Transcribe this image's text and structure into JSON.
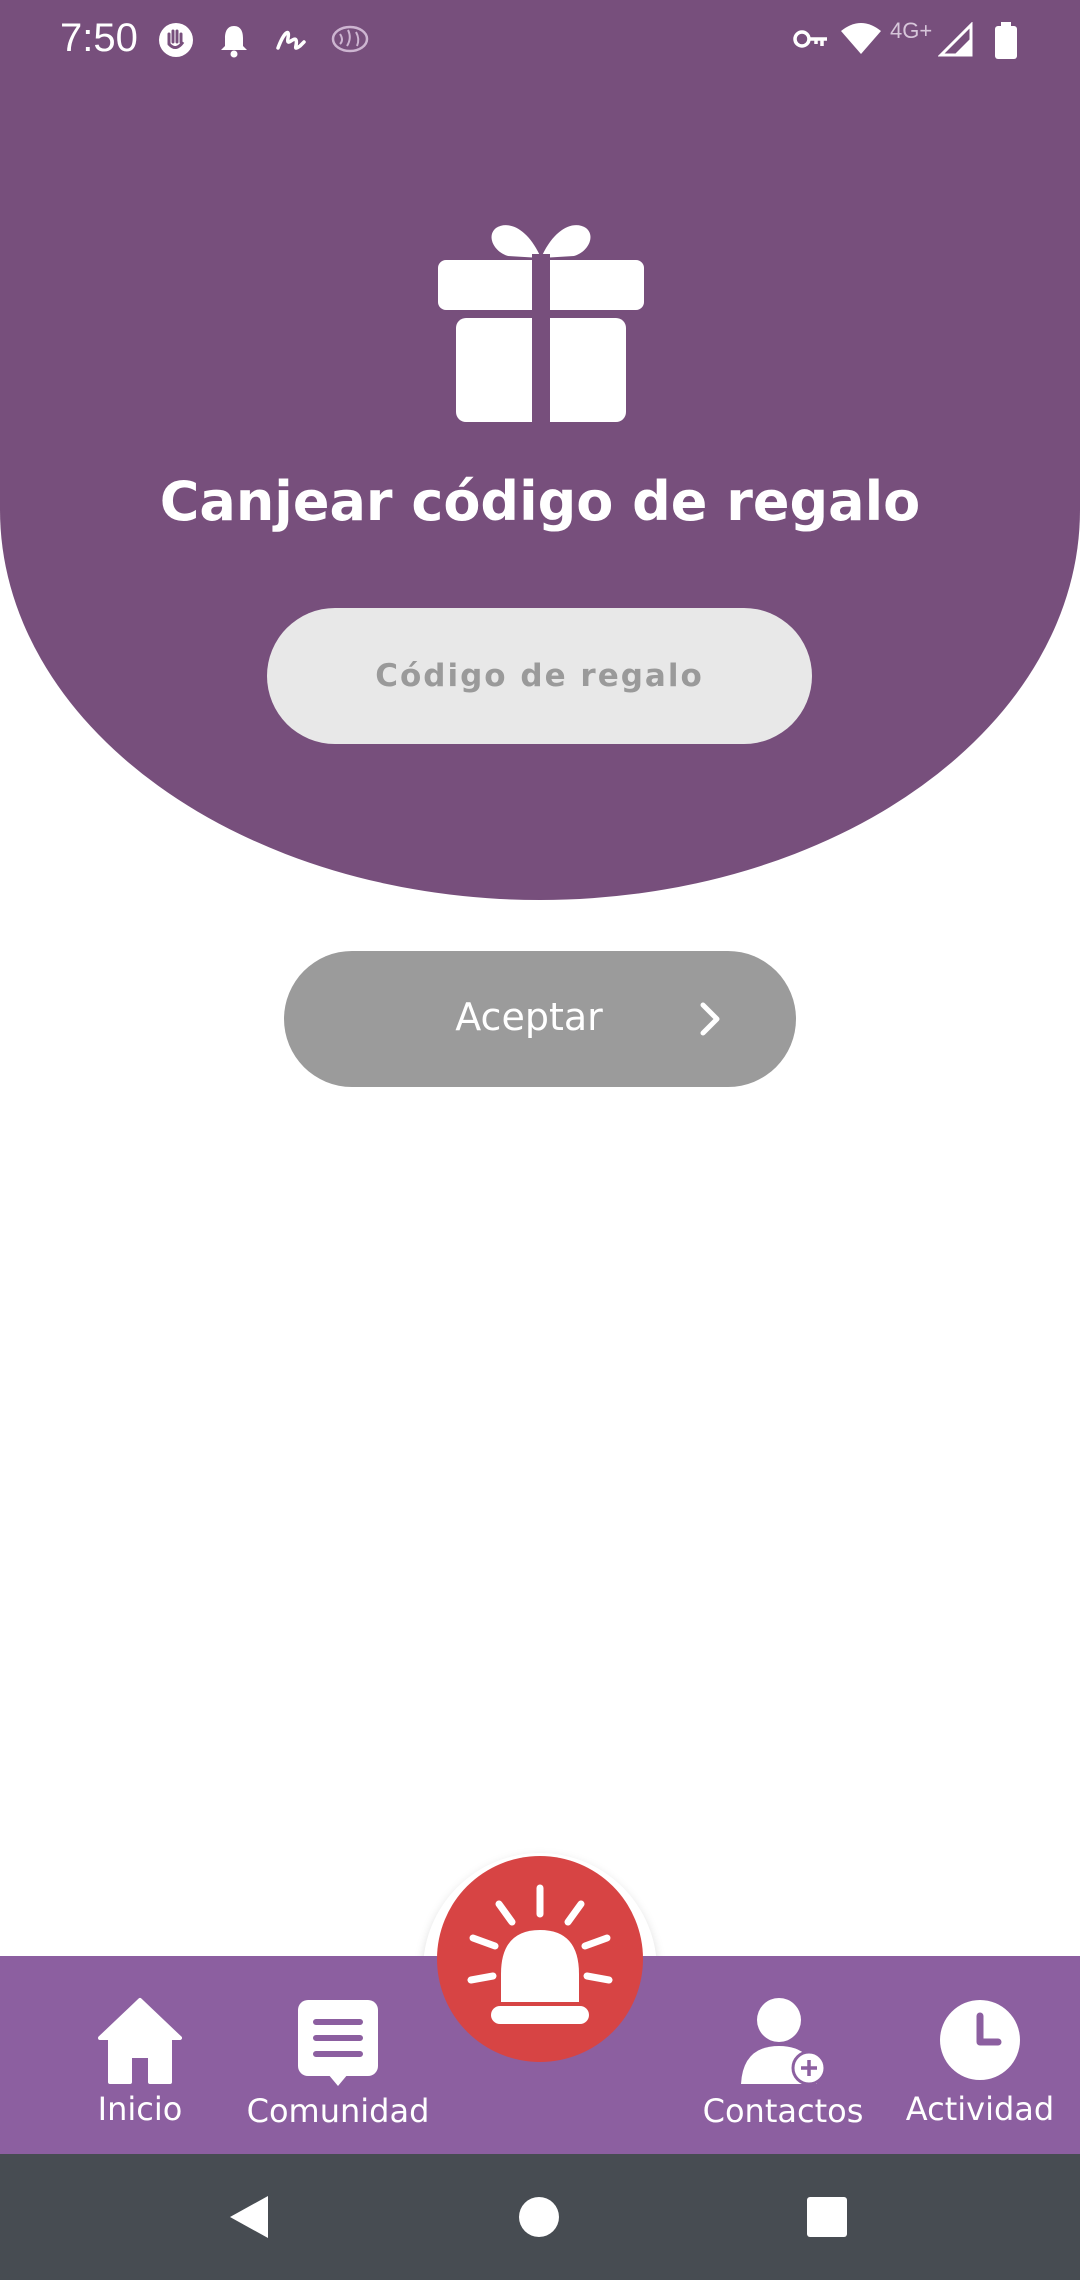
{
  "status_bar": {
    "time": "7:50",
    "network": "4G+",
    "icons": [
      "hand-icon",
      "notification-bell-icon",
      "signature-icon",
      "brain-icon",
      "vpn-key-icon",
      "wifi-icon",
      "signal-icon",
      "battery-icon"
    ]
  },
  "main": {
    "icon": "gift-icon",
    "title": "Canjear código de regalo",
    "input_placeholder": "Código de regalo",
    "input_value": "",
    "accept_label": "Aceptar"
  },
  "bottom_nav": {
    "items": [
      {
        "label": "Inicio",
        "icon": "home-icon"
      },
      {
        "label": "Comunidad",
        "icon": "community-chat-icon"
      },
      {
        "label": "Contactos",
        "icon": "add-contact-icon"
      },
      {
        "label": "Actividad",
        "icon": "clock-icon"
      }
    ],
    "center_button_icon": "alarm-siren-icon"
  },
  "colors": {
    "header_purple": "#774f7c",
    "nav_purple": "#8c5fa0",
    "alarm_red": "#d74444",
    "button_disabled_gray": "#9b9b9b",
    "input_bg": "#e8e8e8",
    "system_nav_bg": "#474c52"
  },
  "system_nav": {
    "buttons": [
      "back-icon",
      "home-circle-icon",
      "recents-icon"
    ]
  }
}
